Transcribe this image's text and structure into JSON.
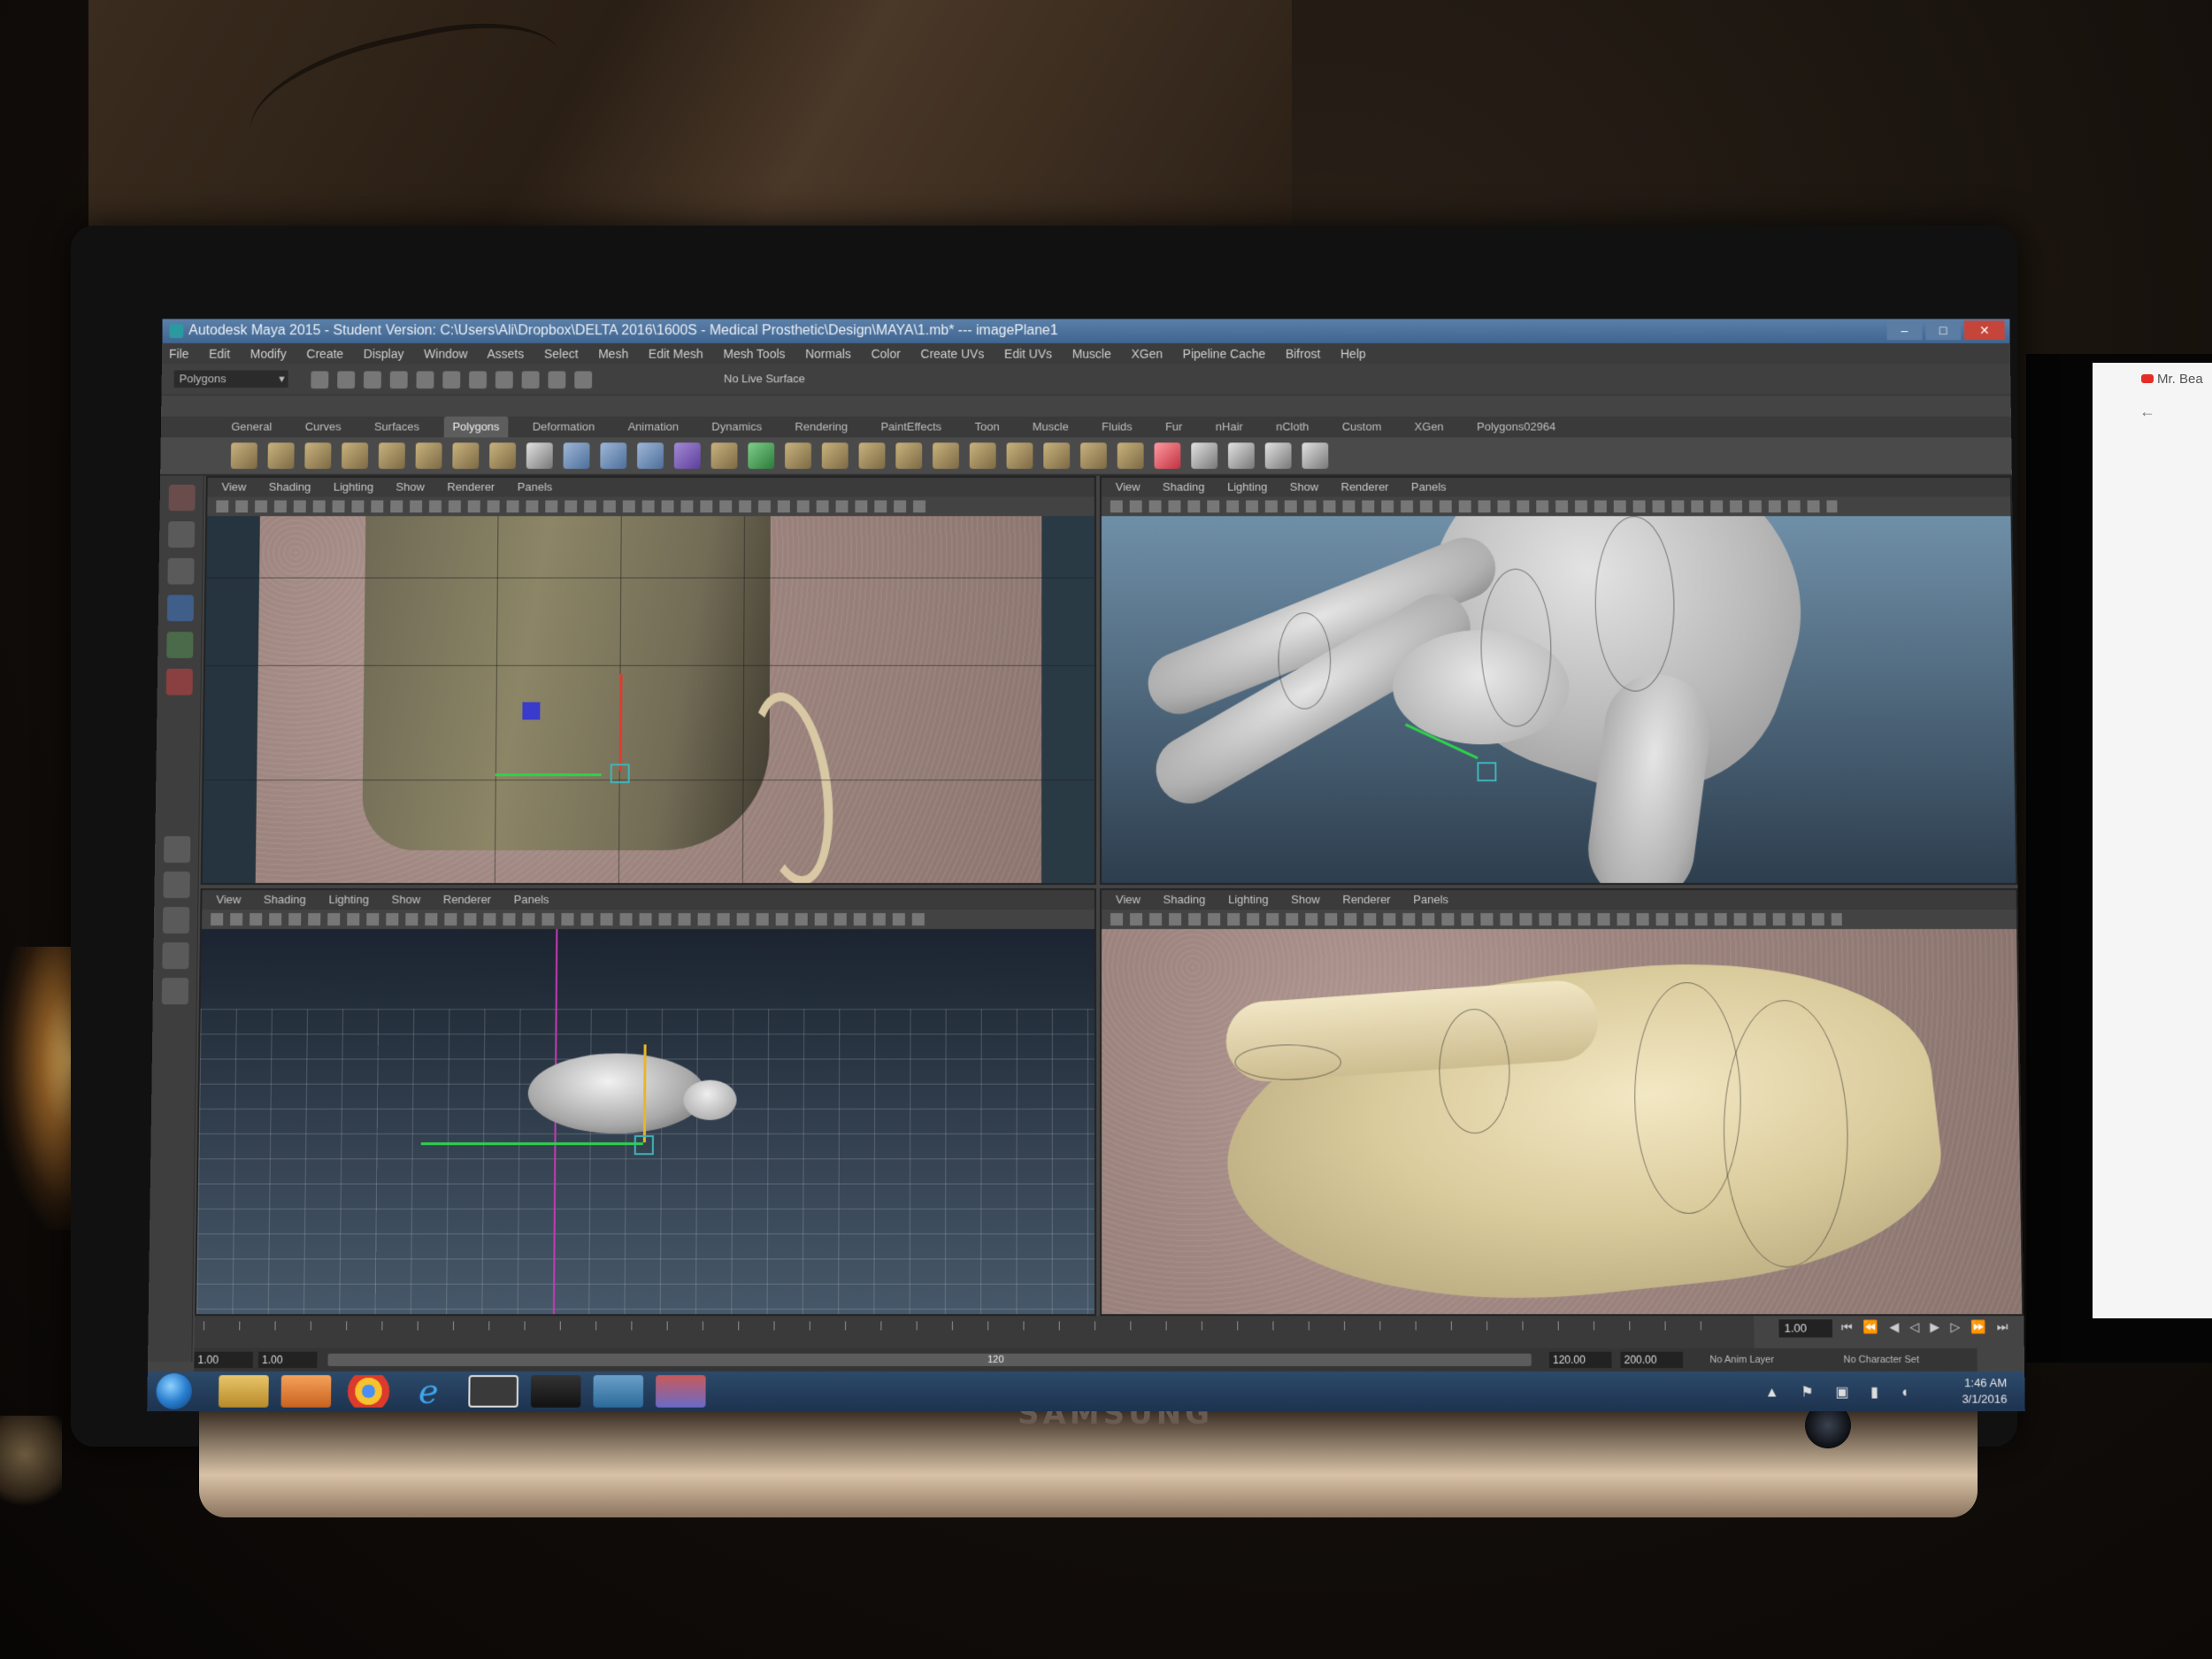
{
  "window": {
    "title": "Autodesk Maya 2015 - Student Version: C:\\Users\\Ali\\Dropbox\\DELTA 2016\\1600S - Medical Prosthetic\\Design\\MAYA\\1.mb* --- imagePlane1"
  },
  "menubar": [
    "File",
    "Edit",
    "Modify",
    "Create",
    "Display",
    "Window",
    "Assets",
    "Select",
    "Mesh",
    "Edit Mesh",
    "Mesh Tools",
    "Normals",
    "Color",
    "Create UVs",
    "Edit UVs",
    "Muscle",
    "XGen",
    "Pipeline Cache",
    "Bifrost",
    "Help"
  ],
  "status_line": {
    "mode": "Polygons",
    "live_surface": "No Live Surface"
  },
  "shelf_tabs": [
    "General",
    "Curves",
    "Surfaces",
    "Polygons",
    "Deformation",
    "Animation",
    "Dynamics",
    "Rendering",
    "PaintEffects",
    "Toon",
    "Muscle",
    "Fluids",
    "Fur",
    "nHair",
    "nCloth",
    "Custom",
    "XGen",
    "Polygons02964"
  ],
  "active_shelf_tab": "Polygons",
  "viewport_menu": [
    "View",
    "Shading",
    "Lighting",
    "Show",
    "Renderer",
    "Panels"
  ],
  "timeline": {
    "current_frame": "1.00",
    "range_start": "1.00",
    "range_min": "1.00",
    "range_mid": "120",
    "range_end": "120.00",
    "range_max": "200.00",
    "anim_layer": "No Anim Layer",
    "character_set": "No Character Set"
  },
  "taskbar": {
    "time": "1:46 AM",
    "date": "3/1/2016"
  },
  "monitor": {
    "brand": "SAMSUNG"
  },
  "side_screen": {
    "tab_text": "Mr. Bea"
  }
}
